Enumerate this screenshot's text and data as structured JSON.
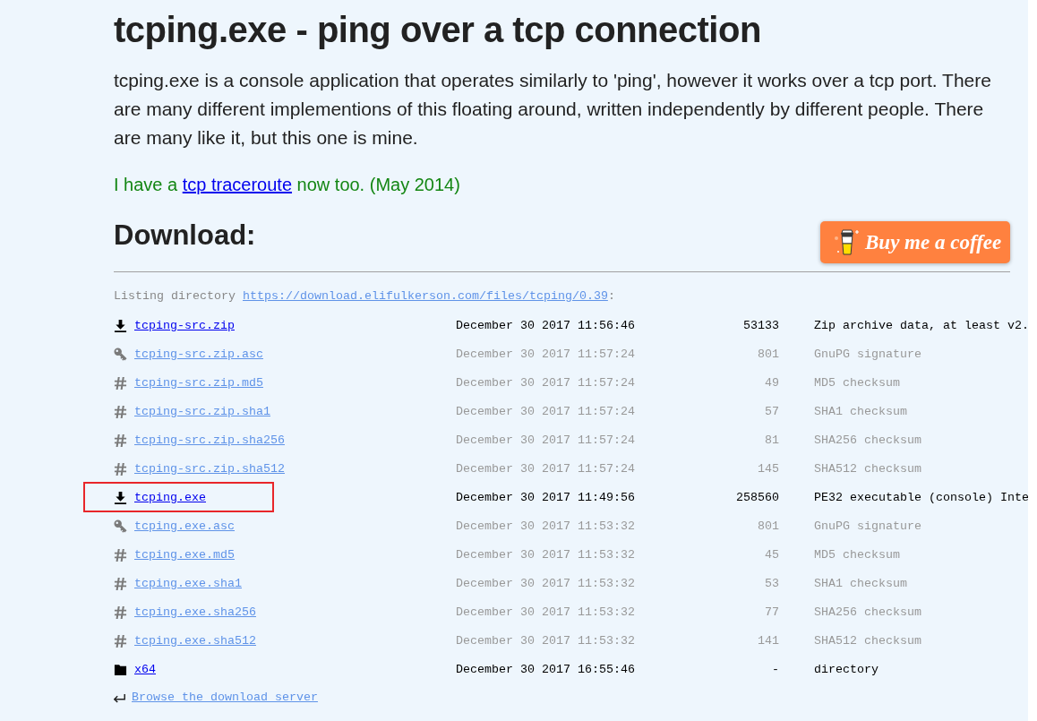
{
  "title": "tcping.exe - ping over a tcp connection",
  "intro": "tcping.exe is a console application that operates similarly to 'ping', however it works over a tcp port. There are many different implementions of this floating around, written independently by different people. There are many like it, but this one is mine.",
  "note": {
    "before": "I have a ",
    "link": "tcp traceroute",
    "after": " now too. (May 2014)"
  },
  "download": {
    "heading": "Download:",
    "coffee_button": "Buy me a coffee"
  },
  "listing": {
    "caption": {
      "before": "Listing directory ",
      "link": "https://download.elifulkerson.com/files/tcping/0.39",
      "after": ":"
    },
    "files": [
      {
        "kind": "download",
        "name": "tcping-src.zip",
        "date": "December 30 2017 11:56:46",
        "size": "53133",
        "description": "Zip archive data, at least v2.",
        "dimmed": false,
        "highlighted": false
      },
      {
        "kind": "signature",
        "name": "tcping-src.zip.asc",
        "date": "December 30 2017 11:57:24",
        "size": "801",
        "description": "GnuPG signature",
        "dimmed": true,
        "highlighted": false
      },
      {
        "kind": "checksum",
        "name": "tcping-src.zip.md5",
        "date": "December 30 2017 11:57:24",
        "size": "49",
        "description": "MD5 checksum",
        "dimmed": true,
        "highlighted": false
      },
      {
        "kind": "checksum",
        "name": "tcping-src.zip.sha1",
        "date": "December 30 2017 11:57:24",
        "size": "57",
        "description": "SHA1 checksum",
        "dimmed": true,
        "highlighted": false
      },
      {
        "kind": "checksum",
        "name": "tcping-src.zip.sha256",
        "date": "December 30 2017 11:57:24",
        "size": "81",
        "description": "SHA256 checksum",
        "dimmed": true,
        "highlighted": false
      },
      {
        "kind": "checksum",
        "name": "tcping-src.zip.sha512",
        "date": "December 30 2017 11:57:24",
        "size": "145",
        "description": "SHA512 checksum",
        "dimmed": true,
        "highlighted": false
      },
      {
        "kind": "download",
        "name": "tcping.exe",
        "date": "December 30 2017 11:49:56",
        "size": "258560",
        "description": "PE32 executable (console) Inte",
        "dimmed": false,
        "highlighted": true
      },
      {
        "kind": "signature",
        "name": "tcping.exe.asc",
        "date": "December 30 2017 11:53:32",
        "size": "801",
        "description": "GnuPG signature",
        "dimmed": true,
        "highlighted": false
      },
      {
        "kind": "checksum",
        "name": "tcping.exe.md5",
        "date": "December 30 2017 11:53:32",
        "size": "45",
        "description": "MD5 checksum",
        "dimmed": true,
        "highlighted": false
      },
      {
        "kind": "checksum",
        "name": "tcping.exe.sha1",
        "date": "December 30 2017 11:53:32",
        "size": "53",
        "description": "SHA1 checksum",
        "dimmed": true,
        "highlighted": false
      },
      {
        "kind": "checksum",
        "name": "tcping.exe.sha256",
        "date": "December 30 2017 11:53:32",
        "size": "77",
        "description": "SHA256 checksum",
        "dimmed": true,
        "highlighted": false
      },
      {
        "kind": "checksum",
        "name": "tcping.exe.sha512",
        "date": "December 30 2017 11:53:32",
        "size": "141",
        "description": "SHA512 checksum",
        "dimmed": true,
        "highlighted": false
      },
      {
        "kind": "directory",
        "name": "x64",
        "date": "December 30 2017 16:55:46",
        "size": "-",
        "description": "directory",
        "dimmed": false,
        "highlighted": false
      }
    ],
    "browse_link": "Browse the download server"
  }
}
